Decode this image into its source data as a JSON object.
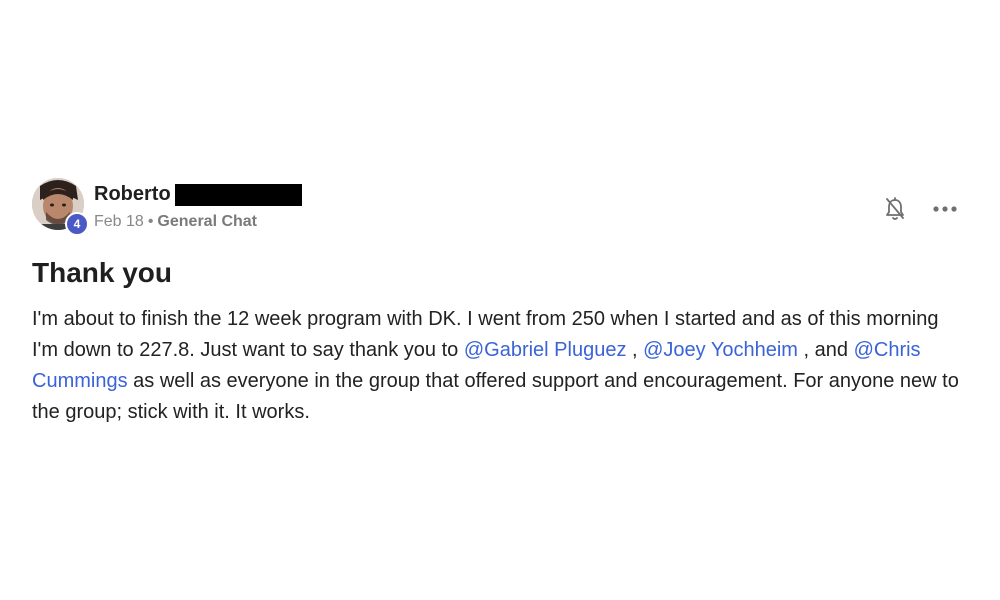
{
  "author": {
    "name": "Roberto",
    "level": "4"
  },
  "meta": {
    "date": "Feb 18",
    "separator": "•",
    "category": "General Chat"
  },
  "icons": {
    "notification": "bell-off-icon",
    "more": "more-horizontal-icon"
  },
  "post": {
    "title": "Thank you",
    "text_1": "I'm about to finish the 12 week program with DK. I went from 250 when I started and as of this morning I'm down to 227.8. Just want to say thank you to ",
    "mention_1": "@Gabriel Pluguez",
    "text_2": " , ",
    "mention_2": "@Joey Yochheim",
    "text_3": " , and ",
    "mention_3": "@Chris Cummings",
    "text_4": " as well as everyone in the group that offered support and encouragement. For anyone new to the group; stick with it. It works."
  },
  "colors": {
    "mention": "#3a63d8",
    "badge": "#4a59c6",
    "meta": "#888888"
  }
}
